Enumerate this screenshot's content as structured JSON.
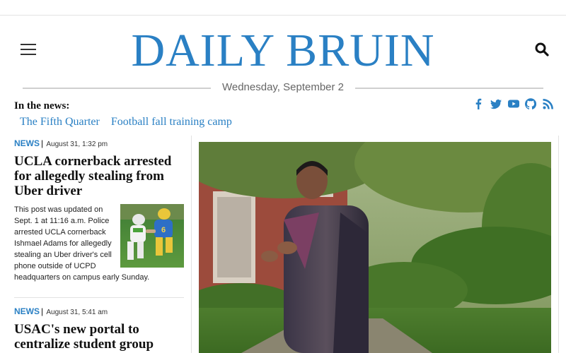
{
  "masthead": {
    "title": "DAILY BRUIN",
    "date": "Wednesday, September 2"
  },
  "in_the_news": {
    "label": "In the news:",
    "links": [
      "The Fifth Quarter",
      "Football fall training camp"
    ]
  },
  "social": [
    "facebook-icon",
    "twitter-icon",
    "youtube-icon",
    "github-icon",
    "rss-icon"
  ],
  "stories": [
    {
      "category": "NEWS",
      "separator": "|",
      "timestamp": "August 31, 1:32 pm",
      "headline": "UCLA cornerback arrested for allegedly stealing from Uber driver",
      "body": "This post was updated on Sept. 1 at 11:16 a.m. Police arrested UCLA cornerback Ishmael Adams for allegedly stealing an Uber driver's cell phone outside of UCPD headquarters on campus early Sunday."
    },
    {
      "category": "NEWS",
      "separator": "|",
      "timestamp": "August 31, 5:41 am",
      "headline": "USAC's new portal to centralize student group"
    }
  ],
  "colors": {
    "brand_blue": "#2a80c4",
    "rule_gray": "#cfcfcf",
    "text": "#111111"
  }
}
